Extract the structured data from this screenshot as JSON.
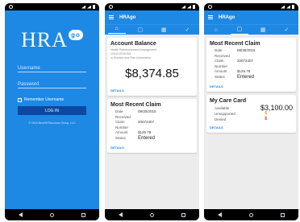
{
  "login": {
    "logo_text": "HRA",
    "logo_badge": "go",
    "username_placeholder": "Username",
    "password_placeholder": "Password",
    "remember_label": "Remember Username",
    "login_button": "LOG IN",
    "copyright": "© 2015 Benefit Resource Group, LLC"
  },
  "app": {
    "title": "HRAgo",
    "tab_icons": [
      "home-icon",
      "card-icon",
      "calendar-icon",
      "check-icon"
    ]
  },
  "screen2": {
    "account": {
      "title": "Account Balance",
      "subtitle_lines": [
        "Health Reimbursement Arrangement",
        "1X01010101001",
        "or Election and Plan Information"
      ],
      "amount": "$8,374.85",
      "details": "DETAILS"
    },
    "claim": {
      "title": "Most Recent Claim",
      "rows": [
        {
          "k": "Date Received",
          "v": "08/30/2015"
        },
        {
          "k": "Claim Number",
          "v": "20072407"
        },
        {
          "k": "Amount",
          "v": "$125.78"
        },
        {
          "k": "Status",
          "v": "Entered"
        }
      ],
      "details": "DETAILS"
    }
  },
  "screen3": {
    "claim": {
      "title": "Most Recent Claim",
      "rows": [
        {
          "k": "Date Received",
          "v": "08/30/2015"
        },
        {
          "k": "Claim Number",
          "v": "20072407"
        },
        {
          "k": "Amount",
          "v": "$125.78"
        },
        {
          "k": "Status",
          "v": "Entered"
        }
      ],
      "details": "DETAILS"
    },
    "care_card": {
      "title": "My Care Card",
      "available_label": "Available",
      "available_value": "$3,100.00",
      "unsupported_label": "Unsupported",
      "unsupported_value": "$",
      "denied_label": "Denied",
      "denied_value": "$",
      "details": "DETAILS"
    }
  },
  "colors": {
    "primary": "#1e88e5",
    "primary_dark": "#0d47a1",
    "accent_orange": "#f59b00",
    "accent_red": "#e53935"
  }
}
